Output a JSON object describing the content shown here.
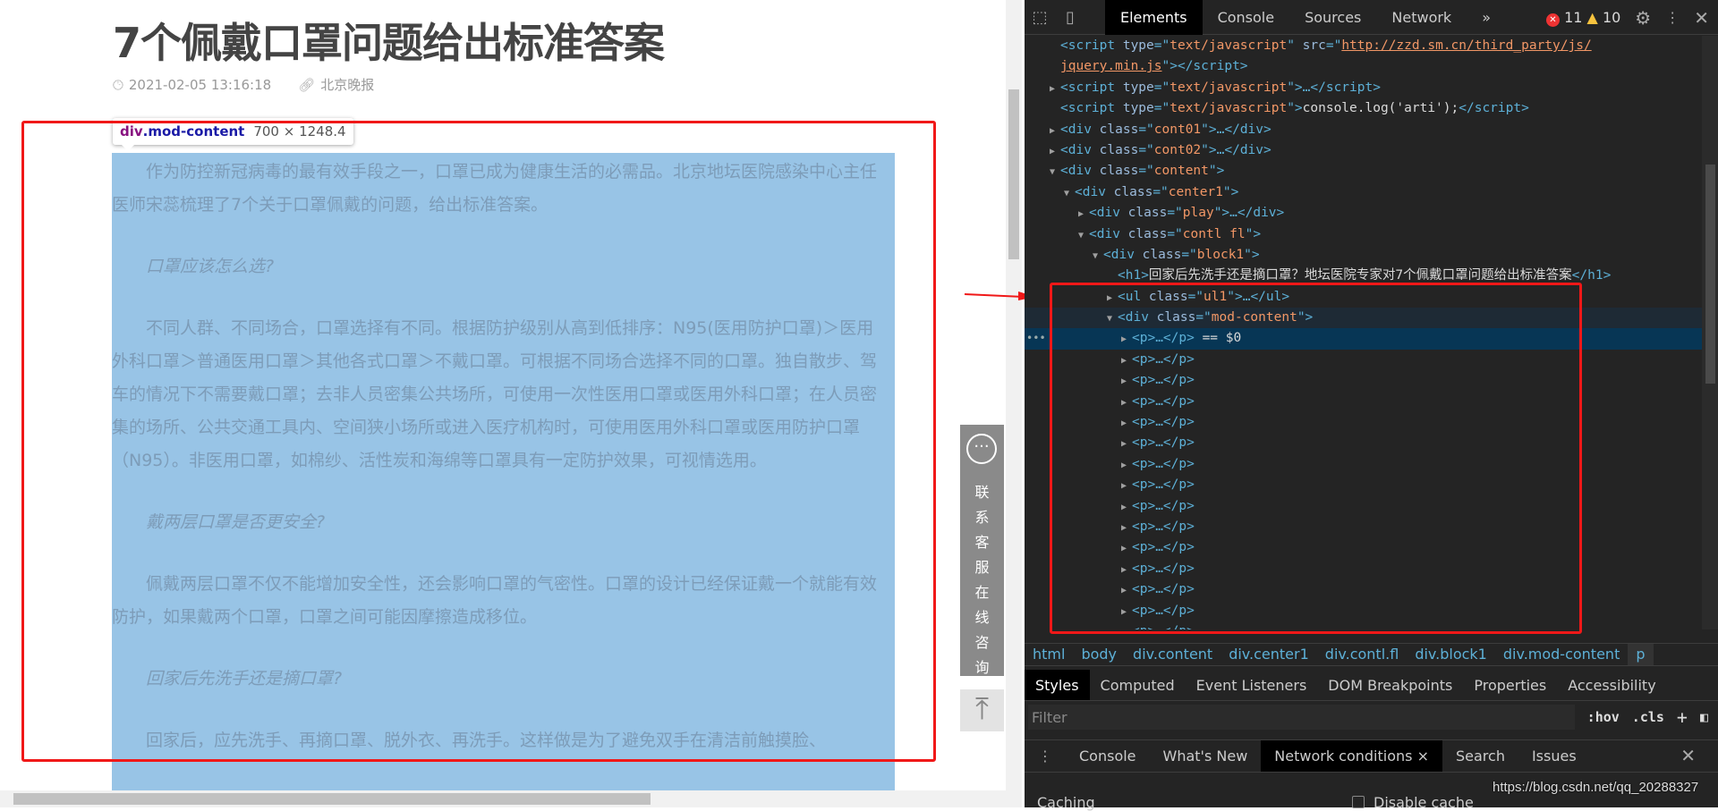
{
  "article": {
    "title": "7个佩戴口罩问题给出标准答案",
    "date": "2021-02-05 13:16:18",
    "source": "北京晚报",
    "paragraphs": [
      {
        "text": "作为防控新冠病毒的最有效手段之一，口罩已成为健康生活的必需品。北京地坛医院感染中心主任医师宋蕊梳理了7个关于口罩佩戴的问题，给出标准答案。",
        "question": false
      },
      {
        "text": "口罩应该怎么选?",
        "question": true
      },
      {
        "text": "不同人群、不同场合，口罩选择有不同。根据防护级别从高到低排序：N95(医用防护口罩)＞医用外科口罩＞普通医用口罩＞其他各式口罩＞不戴口罩。可根据不同场合选择不同的口罩。独自散步、驾车的情况下不需要戴口罩；去非人员密集公共场所，可使用一次性医用口罩或医用外科口罩；在人员密集的场所、公共交通工具内、空间狭小场所或进入医疗机构时，可使用医用外科口罩或医用防护口罩（N95）。非医用口罩，如棉纱、活性炭和海绵等口罩具有一定防护效果，可视情选用。",
        "question": false
      },
      {
        "text": "戴两层口罩是否更安全?",
        "question": true
      },
      {
        "text": "佩戴两层口罩不仅不能增加安全性，还会影响口罩的气密性。口罩的设计已经保证戴一个就能有效防护，如果戴两个口罩，口罩之间可能因摩擦造成移位。",
        "question": false
      },
      {
        "text": "回家后先洗手还是摘口罩?",
        "question": true
      },
      {
        "text": "回家后，应先洗手、再摘口罩、脱外衣、再洗手。这样做是为了避免双手在清洁前触摸脸、",
        "question": false
      }
    ]
  },
  "inspector_tooltip": {
    "tag": "div",
    "cls": ".mod-content",
    "size": "700 × 1248.4"
  },
  "side_widget": {
    "label": "联系客服在线咨询",
    "icon": "chat-bubble-icon"
  },
  "devtools": {
    "tabs": [
      "Elements",
      "Console",
      "Sources",
      "Network"
    ],
    "active_tab": "Elements",
    "errors": "11",
    "warnings": "10",
    "tree": [
      {
        "indent": 0,
        "tri": "",
        "parts": [
          [
            "tg",
            "<script "
          ],
          [
            "an",
            "type"
          ],
          [
            "tg",
            "=\""
          ],
          [
            "av",
            "text/javascript"
          ],
          [
            "tg",
            "\" "
          ],
          [
            "an",
            "src"
          ],
          [
            "tg",
            "=\""
          ],
          [
            "lk",
            "http://zzd.sm.cn/third_party/js/"
          ]
        ]
      },
      {
        "indent": 0,
        "tri": "",
        "parts": [
          [
            "lk",
            "jquery.min.js"
          ],
          [
            "tg",
            "\"></script>"
          ]
        ]
      },
      {
        "indent": 0,
        "tri": "▶",
        "parts": [
          [
            "tg",
            "<script "
          ],
          [
            "an",
            "type"
          ],
          [
            "tg",
            "=\""
          ],
          [
            "av",
            "text/javascript"
          ],
          [
            "tg",
            "\">…</script>"
          ]
        ]
      },
      {
        "indent": 0,
        "tri": "",
        "parts": [
          [
            "tg",
            "<script "
          ],
          [
            "an",
            "type"
          ],
          [
            "tg",
            "=\""
          ],
          [
            "av",
            "text/javascript"
          ],
          [
            "tg",
            "\">"
          ],
          [
            "tx",
            "console.log('arti');"
          ],
          [
            "tg",
            "</script>"
          ]
        ]
      },
      {
        "indent": 0,
        "tri": "▶",
        "parts": [
          [
            "tg",
            "<div "
          ],
          [
            "an",
            "class"
          ],
          [
            "tg",
            "=\""
          ],
          [
            "av",
            "cont01"
          ],
          [
            "tg",
            "\">…</div>"
          ]
        ]
      },
      {
        "indent": 0,
        "tri": "▶",
        "parts": [
          [
            "tg",
            "<div "
          ],
          [
            "an",
            "class"
          ],
          [
            "tg",
            "=\""
          ],
          [
            "av",
            "cont02"
          ],
          [
            "tg",
            "\">…</div>"
          ]
        ]
      },
      {
        "indent": 0,
        "tri": "▼",
        "parts": [
          [
            "tg",
            "<div "
          ],
          [
            "an",
            "class"
          ],
          [
            "tg",
            "=\""
          ],
          [
            "av",
            "content"
          ],
          [
            "tg",
            "\">"
          ]
        ]
      },
      {
        "indent": 1,
        "tri": "▼",
        "parts": [
          [
            "tg",
            "<div "
          ],
          [
            "an",
            "class"
          ],
          [
            "tg",
            "=\""
          ],
          [
            "av",
            "center1"
          ],
          [
            "tg",
            "\">"
          ]
        ]
      },
      {
        "indent": 2,
        "tri": "▶",
        "parts": [
          [
            "tg",
            "<div "
          ],
          [
            "an",
            "class"
          ],
          [
            "tg",
            "=\""
          ],
          [
            "av",
            "play"
          ],
          [
            "tg",
            "\">…</div>"
          ]
        ]
      },
      {
        "indent": 2,
        "tri": "▼",
        "parts": [
          [
            "tg",
            "<div "
          ],
          [
            "an",
            "class"
          ],
          [
            "tg",
            "=\""
          ],
          [
            "av",
            "contl fl"
          ],
          [
            "tg",
            "\">"
          ]
        ]
      },
      {
        "indent": 3,
        "tri": "▼",
        "parts": [
          [
            "tg",
            "<div "
          ],
          [
            "an",
            "class"
          ],
          [
            "tg",
            "=\""
          ],
          [
            "av",
            "block1"
          ],
          [
            "tg",
            "\">"
          ]
        ]
      },
      {
        "indent": 4,
        "tri": "",
        "parts": [
          [
            "tg",
            "<h1>"
          ],
          [
            "tx",
            "回家后先洗手还是摘口罩？地坛医院专家对7个佩戴口罩问题给出标准答案"
          ],
          [
            "tg",
            "</h1>"
          ]
        ]
      },
      {
        "indent": 4,
        "tri": "▶",
        "parts": [
          [
            "tg",
            "<ul "
          ],
          [
            "an",
            "class"
          ],
          [
            "tg",
            "=\""
          ],
          [
            "av",
            "ul1"
          ],
          [
            "tg",
            "\">…</ul>"
          ]
        ]
      },
      {
        "indent": 4,
        "tri": "▼",
        "state": "hover",
        "parts": [
          [
            "tg",
            "<div "
          ],
          [
            "an",
            "class"
          ],
          [
            "tg",
            "=\""
          ],
          [
            "av",
            "mod-content"
          ],
          [
            "tg",
            "\">"
          ]
        ]
      },
      {
        "indent": 5,
        "tri": "▶",
        "state": "selected",
        "parts": [
          [
            "tg",
            "<p>…</p>"
          ],
          [
            "tx",
            " == $0"
          ]
        ]
      },
      {
        "indent": 5,
        "tri": "▶",
        "parts": [
          [
            "tg",
            "<p>…</p>"
          ]
        ]
      },
      {
        "indent": 5,
        "tri": "▶",
        "parts": [
          [
            "tg",
            "<p>…</p>"
          ]
        ]
      },
      {
        "indent": 5,
        "tri": "▶",
        "parts": [
          [
            "tg",
            "<p>…</p>"
          ]
        ]
      },
      {
        "indent": 5,
        "tri": "▶",
        "parts": [
          [
            "tg",
            "<p>…</p>"
          ]
        ]
      },
      {
        "indent": 5,
        "tri": "▶",
        "parts": [
          [
            "tg",
            "<p>…</p>"
          ]
        ]
      },
      {
        "indent": 5,
        "tri": "▶",
        "parts": [
          [
            "tg",
            "<p>…</p>"
          ]
        ]
      },
      {
        "indent": 5,
        "tri": "▶",
        "parts": [
          [
            "tg",
            "<p>…</p>"
          ]
        ]
      },
      {
        "indent": 5,
        "tri": "▶",
        "parts": [
          [
            "tg",
            "<p>…</p>"
          ]
        ]
      },
      {
        "indent": 5,
        "tri": "▶",
        "parts": [
          [
            "tg",
            "<p>…</p>"
          ]
        ]
      },
      {
        "indent": 5,
        "tri": "▶",
        "parts": [
          [
            "tg",
            "<p>…</p>"
          ]
        ]
      },
      {
        "indent": 5,
        "tri": "▶",
        "parts": [
          [
            "tg",
            "<p>…</p>"
          ]
        ]
      },
      {
        "indent": 5,
        "tri": "▶",
        "parts": [
          [
            "tg",
            "<p>…</p>"
          ]
        ]
      },
      {
        "indent": 5,
        "tri": "▶",
        "parts": [
          [
            "tg",
            "<p>…</p>"
          ]
        ]
      },
      {
        "indent": 5,
        "tri": "▶",
        "parts": [
          [
            "tg",
            "<p>…</p>"
          ]
        ]
      }
    ],
    "breadcrumb": [
      "html",
      "body",
      "div.content",
      "div.center1",
      "div.contl.fl",
      "div.block1",
      "div.mod-content",
      "p"
    ],
    "style_tabs": [
      "Styles",
      "Computed",
      "Event Listeners",
      "DOM Breakpoints",
      "Properties",
      "Accessibility"
    ],
    "filter_placeholder": "Filter",
    "hov": ":hov",
    "cls": ".cls",
    "drawer_tabs": [
      "Console",
      "What's New",
      "Network conditions",
      "Search",
      "Issues"
    ],
    "drawer_active": "Network conditions",
    "caching_label": "Caching",
    "disable_cache_label": "Disable cache"
  },
  "watermark": "https://blog.csdn.net/qq_20288327",
  "colors": {
    "highlight": "#98c4e6",
    "annotation_red": "#f01818",
    "selected_row": "#073655"
  }
}
